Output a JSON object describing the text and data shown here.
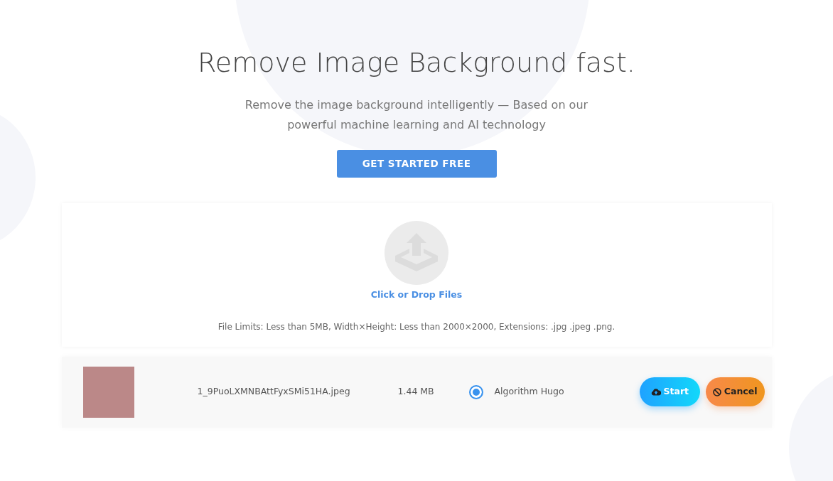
{
  "hero": {
    "title": "Remove Image Background fast.",
    "subtitle": "Remove the image background intelligently — Based on our powerful machine learning and AI technology",
    "cta": "GET STARTED FREE"
  },
  "upload": {
    "label": "Click or Drop Files",
    "limits": "File Limits: Less than 5MB, Width×Height: Less than 2000×2000, Extensions: .jpg .jpeg .png."
  },
  "files": [
    {
      "name": "1_9PuoLXMNBAttFyxSMi51HA.jpeg",
      "size": "1.44 MB",
      "options": [
        {
          "label": "Algorithm Hugo",
          "selected": true
        }
      ],
      "actions": [
        {
          "kind": "start",
          "label": "Start"
        },
        {
          "kind": "cancel",
          "label": "Cancel"
        }
      ]
    }
  ]
}
